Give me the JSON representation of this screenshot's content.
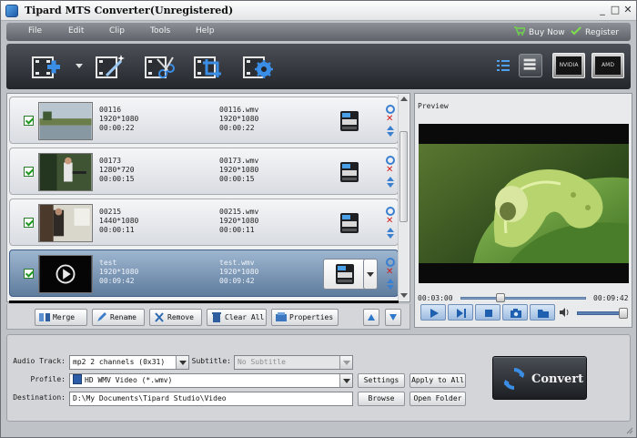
{
  "window": {
    "title": "Tipard MTS Converter(Unregistered)",
    "min_glyph": "_",
    "max_glyph": "□",
    "close_glyph": "✕"
  },
  "menu": {
    "items": [
      "File",
      "Edit",
      "Clip",
      "Tools",
      "Help"
    ],
    "buy_now": "Buy Now",
    "register": "Register"
  },
  "toolbar": {
    "icons": [
      "add-file-icon",
      "effect-wand-icon",
      "trim-icon",
      "crop-icon",
      "settings-icon"
    ],
    "gpu_badges": [
      "NVIDIA",
      "AMD"
    ]
  },
  "files": [
    {
      "name": "00116",
      "resolution": "1920*1080",
      "duration": "00:00:22",
      "output_name": "00116.wmv",
      "output_resolution": "1920*1080",
      "output_duration": "00:00:22",
      "checked": true,
      "selected": false
    },
    {
      "name": "00173",
      "resolution": "1280*720",
      "duration": "00:00:15",
      "output_name": "00173.wmv",
      "output_resolution": "1920*1080",
      "output_duration": "00:00:15",
      "checked": true,
      "selected": false
    },
    {
      "name": "00215",
      "resolution": "1440*1080",
      "duration": "00:00:11",
      "output_name": "00215.wmv",
      "output_resolution": "1920*1080",
      "output_duration": "00:00:11",
      "checked": true,
      "selected": false
    },
    {
      "name": "test",
      "resolution": "1920*1080",
      "duration": "00:09:42",
      "output_name": "test.wmv",
      "output_resolution": "1920*1080",
      "output_duration": "00:09:42",
      "checked": true,
      "selected": true
    }
  ],
  "actions": {
    "merge": "Merge",
    "rename": "Rename",
    "remove": "Remove",
    "clear_all": "Clear All",
    "properties": "Properties"
  },
  "preview": {
    "label": "Preview",
    "current_time": "00:03:00",
    "total_time": "00:09:42",
    "progress": 0.31,
    "volume": 0.9
  },
  "settings": {
    "audio_track_label": "Audio Track:",
    "audio_track_value": "mp2 2 channels (0x31)",
    "subtitle_label": "Subtitle:",
    "subtitle_value": "No Subtitle",
    "profile_label": "Profile:",
    "profile_value": "HD WMV Video (*.wmv)",
    "destination_label": "Destination:",
    "destination_value": "D:\\My Documents\\Tipard Studio\\Video",
    "settings_button": "Settings",
    "apply_to_all_button": "Apply to All",
    "browse_button": "Browse",
    "open_folder_button": "Open Folder",
    "convert_button": "Convert"
  },
  "colors": {
    "accent_blue": "#3a7fd0",
    "selected_row": "#6f8fb2",
    "remove_red": "#d21a1a",
    "check_green": "#1d9a1d"
  }
}
